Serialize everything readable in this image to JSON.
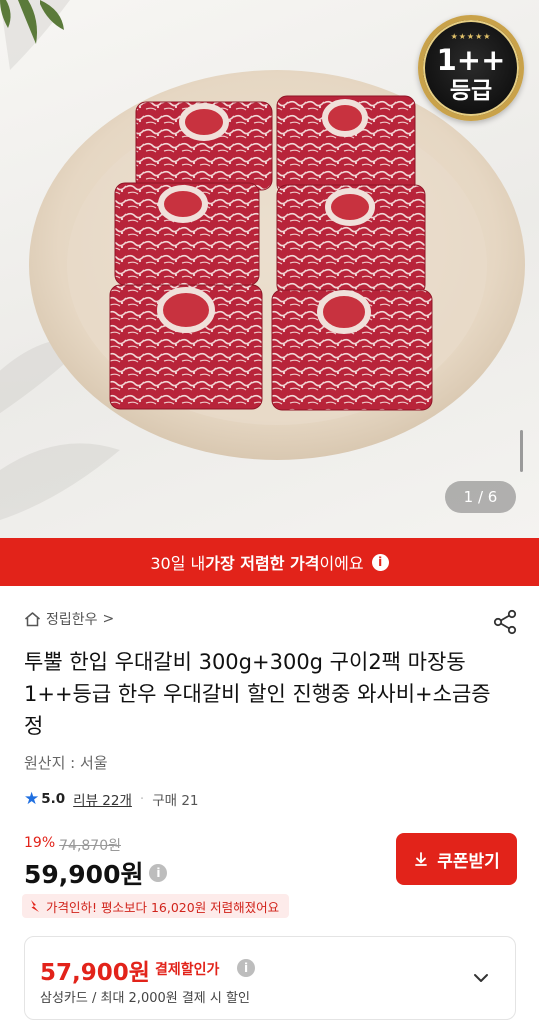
{
  "hero": {
    "grade_badge": {
      "line1": "1++",
      "line2": "등급"
    },
    "page_counter": "1 / 6"
  },
  "banner": {
    "text_before": "30일 내 ",
    "text_bold": "가장 저렴한 가격",
    "text_after": "이에요",
    "info_icon": "i"
  },
  "product": {
    "store_name": "정립한우",
    "store_arrow": ">",
    "title": "투뿔 한입 우대갈비 300g+300g 구이2팩 마장동 1++등급 한우 우대갈비 할인 진행중 와사비+소금증정",
    "origin": "원산지 : 서울",
    "rating": "5.0",
    "review_label": "리뷰 22개",
    "separator": "·",
    "purchase_label": "구매 21"
  },
  "price": {
    "discount_pct": "19%",
    "original_price": "74,870원",
    "sale_price": "59,900원",
    "info_icon": "i",
    "coupon_button_label": "쿠폰받기",
    "price_drop_note": "가격인하! 평소보다 16,020원 저렴해졌어요"
  },
  "card_offer": {
    "price": "57,900원",
    "label": "결제할인가",
    "info_icon": "i",
    "description": "삼성카드 / 최대 2,000원 결제 시 할인"
  },
  "colors": {
    "accent_red": "#e2231a",
    "rating_star": "#1f6fe0",
    "badge_gold": "#c9a24a"
  },
  "icons": [
    "home-store-icon",
    "share-icon",
    "star-icon",
    "download-icon",
    "price-drop-arrow-icon",
    "chevron-down-icon",
    "info-icon"
  ]
}
